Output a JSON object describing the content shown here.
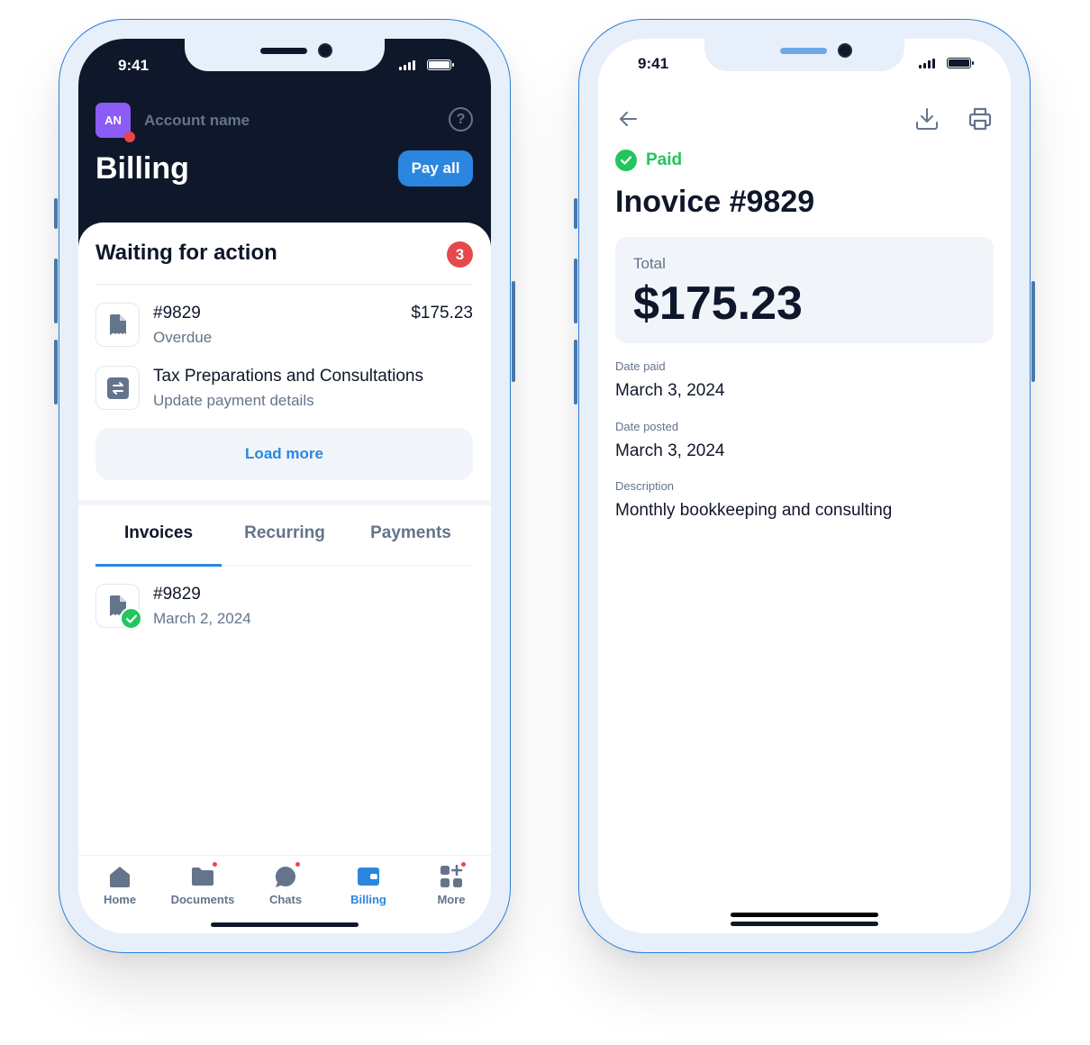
{
  "status_bar": {
    "time": "9:41"
  },
  "billing_screen": {
    "account": {
      "initials": "AN",
      "name": "Account name"
    },
    "title": "Billing",
    "pay_all_label": "Pay all",
    "waiting": {
      "title": "Waiting for action",
      "count": "3",
      "items": [
        {
          "title": "#9829",
          "subtitle": "Overdue",
          "amount": "$175.23",
          "icon": "invoice-icon"
        },
        {
          "title": "Tax Preparations and Consultations",
          "subtitle": "Update payment details",
          "icon": "recurring-icon"
        }
      ],
      "load_more_label": "Load more"
    },
    "tabs": [
      {
        "label": "Invoices",
        "active": true
      },
      {
        "label": "Recurring",
        "active": false
      },
      {
        "label": "Payments",
        "active": false
      }
    ],
    "invoices": [
      {
        "title": "#9829",
        "date": "March 2, 2024",
        "status": "paid"
      }
    ],
    "tabbar": [
      {
        "label": "Home",
        "icon": "home-icon",
        "notification": false
      },
      {
        "label": "Documents",
        "icon": "folder-icon",
        "notification": true
      },
      {
        "label": "Chats",
        "icon": "chat-icon",
        "notification": true
      },
      {
        "label": "Billing",
        "icon": "wallet-icon",
        "active": true,
        "notification": false
      },
      {
        "label": "More",
        "icon": "more-grid-icon",
        "notification": true
      }
    ]
  },
  "invoice_screen": {
    "status": "Paid",
    "title": "Inovice #9829",
    "total_label": "Total",
    "total_value": "$175.23",
    "fields": [
      {
        "label": "Date paid",
        "value": "March 3, 2024"
      },
      {
        "label": "Date posted",
        "value": "March 3, 2024"
      },
      {
        "label": "Description",
        "value": "Monthly bookkeeping and consulting"
      }
    ]
  },
  "colors": {
    "accent": "#2b86e0",
    "dark": "#0f172a",
    "success": "#22c55e",
    "danger": "#e5484d",
    "avatar": "#8b5cf6"
  }
}
